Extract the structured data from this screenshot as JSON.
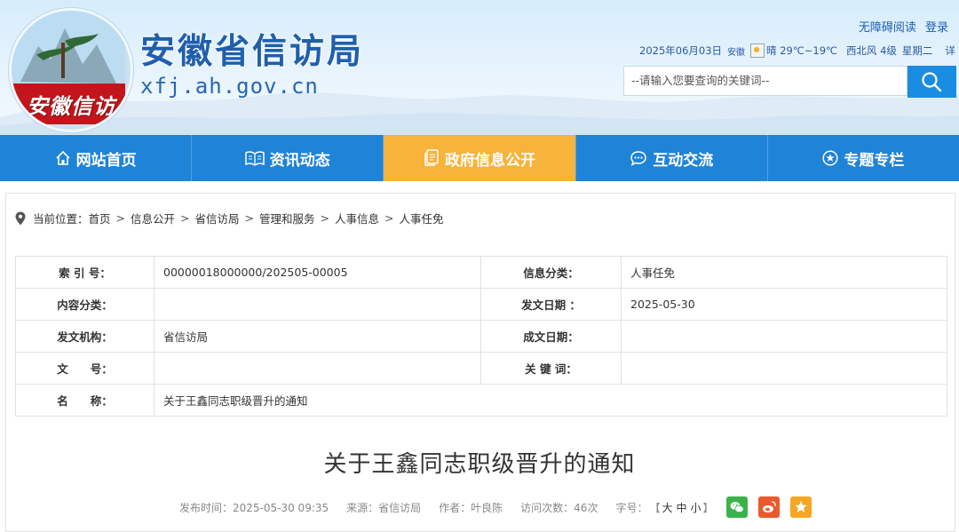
{
  "header": {
    "site_title": "安徽省信访局",
    "site_domain": "xfj.ah.gov.cn",
    "logo_text": "安徽信访",
    "top_links": [
      "无障碍阅读",
      "登录"
    ],
    "date": "2025年06月03日",
    "location": "安徽",
    "weather": "晴 29℃~19℃",
    "wind": "西北风 4级",
    "weekday": "星期二",
    "more": "详"
  },
  "search": {
    "placeholder": "--请输入您要查询的关键词--",
    "button_icon": "search-icon"
  },
  "nav": {
    "items": [
      {
        "label": "网站首页",
        "icon": "home-icon"
      },
      {
        "label": "资讯动态",
        "icon": "book-icon"
      },
      {
        "label": "政府信息公开",
        "icon": "document-icon"
      },
      {
        "label": "互动交流",
        "icon": "chat-icon"
      },
      {
        "label": "专题专栏",
        "icon": "star-circle-icon"
      }
    ],
    "active_color": "#f7b33a",
    "bg_color": "#1f83d8"
  },
  "breadcrumb": {
    "prefix": "当前位置：",
    "items": [
      "首页",
      "信息公开",
      "省信访局",
      "管理和服务",
      "人事信息",
      "人事任免"
    ],
    "separator": ">"
  },
  "meta": {
    "rows": [
      {
        "label1": "索 引 号：",
        "value1": "00000018000000/202505-00005",
        "label2": "信息分类：",
        "value2": "人事任免"
      },
      {
        "label1": "内容分类：",
        "value1": "",
        "label2": "发文日期 ：",
        "value2": "2025-05-30"
      },
      {
        "label1": "发文机构：",
        "value1": "省信访局",
        "label2": "成文日期：",
        "value2": ""
      },
      {
        "label1": "文　　号：",
        "value1": "",
        "label2": "关 键 词：",
        "value2": ""
      },
      {
        "label1": "名　　称：",
        "value1": "关于王鑫同志职级晋升的通知",
        "label2": "",
        "value2": ""
      }
    ]
  },
  "article": {
    "title": "关于王鑫同志职级晋升的通知",
    "publish_time": "发布时间：2025-05-30 09:35",
    "source": "来源：省信访局",
    "author": "作者：叶良陈",
    "views": "访问次数：46次",
    "font_size_label": "字号：",
    "font_sizes": [
      "大",
      "中",
      "小"
    ],
    "share": [
      {
        "name": "wechat",
        "color": "#3bb34a"
      },
      {
        "name": "weibo",
        "color": "#ea5a2b"
      },
      {
        "name": "favorite",
        "color": "#f5a623"
      }
    ]
  }
}
